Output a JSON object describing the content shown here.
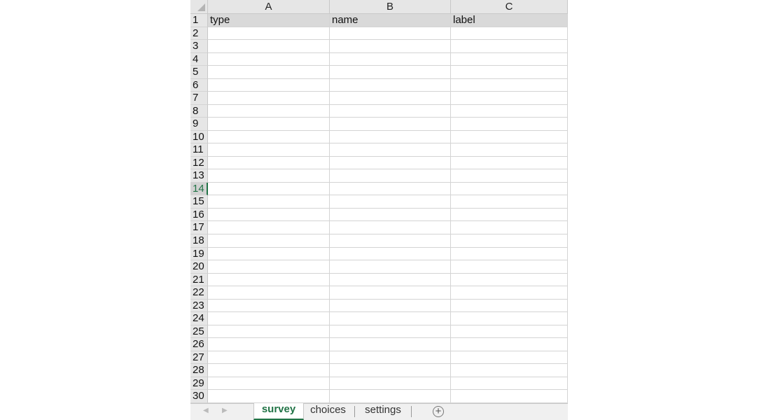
{
  "columns": [
    "A",
    "B",
    "C"
  ],
  "rows": [
    {
      "n": "1",
      "cells": [
        "type",
        "name",
        "label"
      ]
    },
    {
      "n": "2",
      "cells": [
        "",
        "",
        ""
      ]
    },
    {
      "n": "3",
      "cells": [
        "",
        "",
        ""
      ]
    },
    {
      "n": "4",
      "cells": [
        "",
        "",
        ""
      ]
    },
    {
      "n": "5",
      "cells": [
        "",
        "",
        ""
      ]
    },
    {
      "n": "6",
      "cells": [
        "",
        "",
        ""
      ]
    },
    {
      "n": "7",
      "cells": [
        "",
        "",
        ""
      ]
    },
    {
      "n": "8",
      "cells": [
        "",
        "",
        ""
      ]
    },
    {
      "n": "9",
      "cells": [
        "",
        "",
        ""
      ]
    },
    {
      "n": "10",
      "cells": [
        "",
        "",
        ""
      ]
    },
    {
      "n": "11",
      "cells": [
        "",
        "",
        ""
      ]
    },
    {
      "n": "12",
      "cells": [
        "",
        "",
        ""
      ]
    },
    {
      "n": "13",
      "cells": [
        "",
        "",
        ""
      ]
    },
    {
      "n": "14",
      "cells": [
        "",
        "",
        ""
      ]
    },
    {
      "n": "15",
      "cells": [
        "",
        "",
        ""
      ]
    },
    {
      "n": "16",
      "cells": [
        "",
        "",
        ""
      ]
    },
    {
      "n": "17",
      "cells": [
        "",
        "",
        ""
      ]
    },
    {
      "n": "18",
      "cells": [
        "",
        "",
        ""
      ]
    },
    {
      "n": "19",
      "cells": [
        "",
        "",
        ""
      ]
    },
    {
      "n": "20",
      "cells": [
        "",
        "",
        ""
      ]
    },
    {
      "n": "21",
      "cells": [
        "",
        "",
        ""
      ]
    },
    {
      "n": "22",
      "cells": [
        "",
        "",
        ""
      ]
    },
    {
      "n": "23",
      "cells": [
        "",
        "",
        ""
      ]
    },
    {
      "n": "24",
      "cells": [
        "",
        "",
        ""
      ]
    },
    {
      "n": "25",
      "cells": [
        "",
        "",
        ""
      ]
    },
    {
      "n": "26",
      "cells": [
        "",
        "",
        ""
      ]
    },
    {
      "n": "27",
      "cells": [
        "",
        "",
        ""
      ]
    },
    {
      "n": "28",
      "cells": [
        "",
        "",
        ""
      ]
    },
    {
      "n": "29",
      "cells": [
        "",
        "",
        ""
      ]
    },
    {
      "n": "30",
      "cells": [
        "",
        "",
        ""
      ]
    }
  ],
  "selected_row": "14",
  "sheet_tabs": [
    {
      "label": "survey",
      "active": true
    },
    {
      "label": "choices",
      "active": false
    },
    {
      "label": "settings",
      "active": false
    }
  ],
  "icons": {
    "prev": "triangle-left-icon",
    "next": "triangle-right-icon",
    "add": "plus-circle-icon"
  },
  "accent_color": "#217346"
}
